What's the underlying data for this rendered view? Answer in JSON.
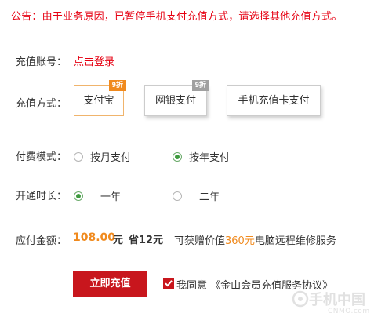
{
  "notice": "公告：由于业务原因，已暂停手机支付充值方式，请选择其他充值方式。",
  "account": {
    "label": "充值账号：",
    "login_link": "点击登录"
  },
  "method": {
    "label": "充值方式：",
    "options": [
      {
        "label": "支付宝",
        "badge": "9折",
        "selected": true
      },
      {
        "label": "网银支付",
        "badge": "9折",
        "selected": false
      },
      {
        "label": "手机充值卡支付",
        "badge": "",
        "selected": false
      }
    ]
  },
  "billing": {
    "label": "付费模式：",
    "options": [
      {
        "label": "按月支付",
        "selected": false
      },
      {
        "label": "按年支付",
        "selected": true
      }
    ]
  },
  "duration": {
    "label": "开通时长：",
    "options": [
      {
        "label": "一年",
        "selected": true
      },
      {
        "label": "二年",
        "selected": false
      }
    ]
  },
  "payment": {
    "label": "应付金额：",
    "amount": "108.00",
    "unit": "元",
    "save": "省12元",
    "gift_prefix": "可获赠价值",
    "gift_value": "360元",
    "gift_suffix": "电脑远程维修服务"
  },
  "actions": {
    "pay_button": "立即充值",
    "agree_prefix": "我同意",
    "agree_link": "《金山会员充值服务协议》",
    "agree_checked": true
  },
  "watermark": {
    "line1": "手机中国",
    "line2": "CNMO.com"
  },
  "colors": {
    "accent_red": "#e60012",
    "button_red": "#c8161d",
    "orange": "#f08a1e",
    "radio_green": "#3e9a3e"
  }
}
